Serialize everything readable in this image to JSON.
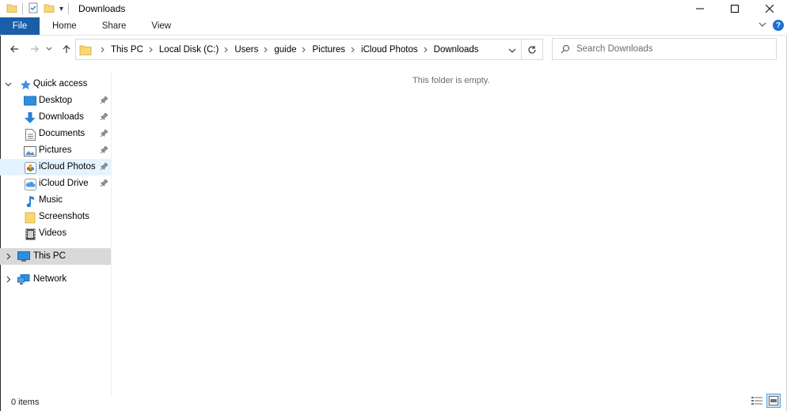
{
  "window": {
    "title": "Downloads",
    "quick_access_dropdown": "▾"
  },
  "ribbon": {
    "tabs": [
      {
        "label": "File"
      },
      {
        "label": "Home"
      },
      {
        "label": "Share"
      },
      {
        "label": "View"
      }
    ],
    "help_label": "?"
  },
  "address": {
    "breadcrumbs": [
      "This PC",
      "Local Disk (C:)",
      "Users",
      "guide",
      "Pictures",
      "iCloud Photos",
      "Downloads"
    ]
  },
  "search": {
    "placeholder": "Search Downloads"
  },
  "sidebar": {
    "quick_access_label": "Quick access",
    "quick_items": [
      {
        "label": "Desktop",
        "icon": "desktop-icon",
        "pinned": true
      },
      {
        "label": "Downloads",
        "icon": "downloads-arrow-icon",
        "pinned": true
      },
      {
        "label": "Documents",
        "icon": "documents-icon",
        "pinned": true
      },
      {
        "label": "Pictures",
        "icon": "pictures-icon",
        "pinned": true
      },
      {
        "label": "iCloud Photos",
        "icon": "icloud-photos-icon",
        "pinned": true
      },
      {
        "label": "iCloud Drive",
        "icon": "icloud-drive-icon",
        "pinned": true
      },
      {
        "label": "Music",
        "icon": "music-note-icon",
        "pinned": false
      },
      {
        "label": "Screenshots",
        "icon": "folder-icon",
        "pinned": false
      },
      {
        "label": "Videos",
        "icon": "videos-icon",
        "pinned": false
      }
    ],
    "this_pc_label": "This PC",
    "network_label": "Network"
  },
  "content": {
    "empty_message": "This folder is empty."
  },
  "status": {
    "item_count": "0 items"
  },
  "colors": {
    "file_tab": "#1a5ea8",
    "folder": "#f8d775",
    "accent": "#1a70d0",
    "selected_row": "#d9d9d9",
    "hover_row": "#e5f3ff"
  }
}
